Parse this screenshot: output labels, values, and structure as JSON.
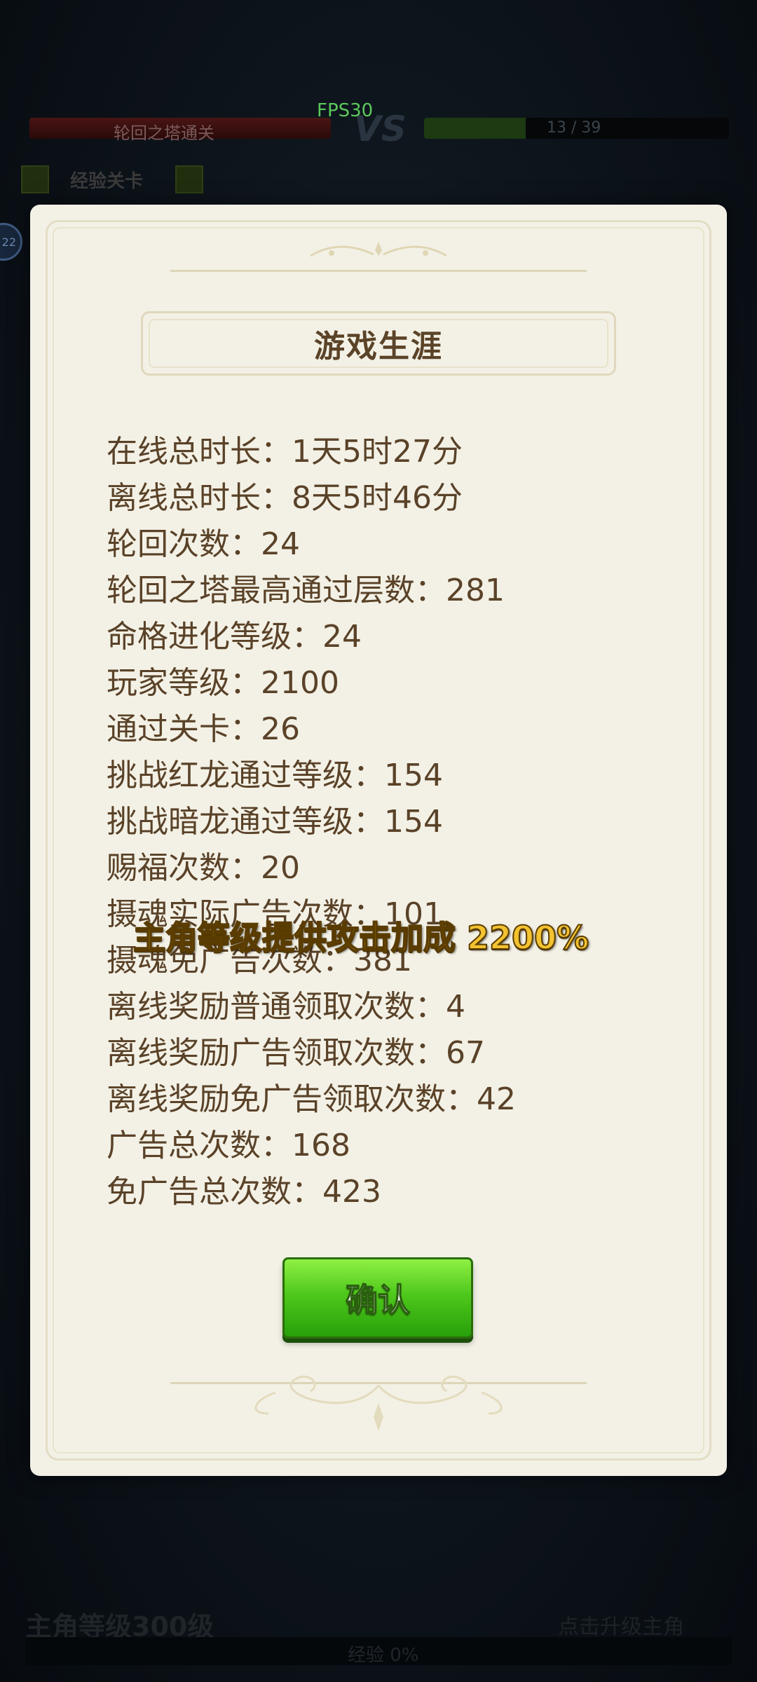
{
  "hud": {
    "fps": "FPS30",
    "left_bar_text": "轮回之塔通关",
    "vs": "VS",
    "right_bar_text": "13 / 39",
    "stage_label": "经验关卡",
    "avatar_badge": "22"
  },
  "dialog": {
    "title": "游戏生涯",
    "stats": [
      "在线总时长：1天5时27分",
      "离线总时长：8天5时46分",
      "轮回次数：24",
      "轮回之塔最高通过层数：281",
      "命格进化等级：24",
      "玩家等级：2100",
      "通过关卡：26",
      "挑战红龙通过等级：154",
      "挑战暗龙通过等级：154",
      "赐福次数：20",
      "摄魂实际广告次数：101",
      "摄魂免广告次数：381",
      "离线奖励普通领取次数：4",
      "离线奖励广告领取次数：67",
      "离线奖励免广告领取次数：42",
      "广告总次数：168",
      "免广告总次数：423"
    ],
    "confirm_label": "确认"
  },
  "floating_text": "主角等级提供攻击加成 2200%",
  "bottom": {
    "level_text": "主角等级300级",
    "right_text": "点击升级主角",
    "exp_text": "经验 0%"
  }
}
